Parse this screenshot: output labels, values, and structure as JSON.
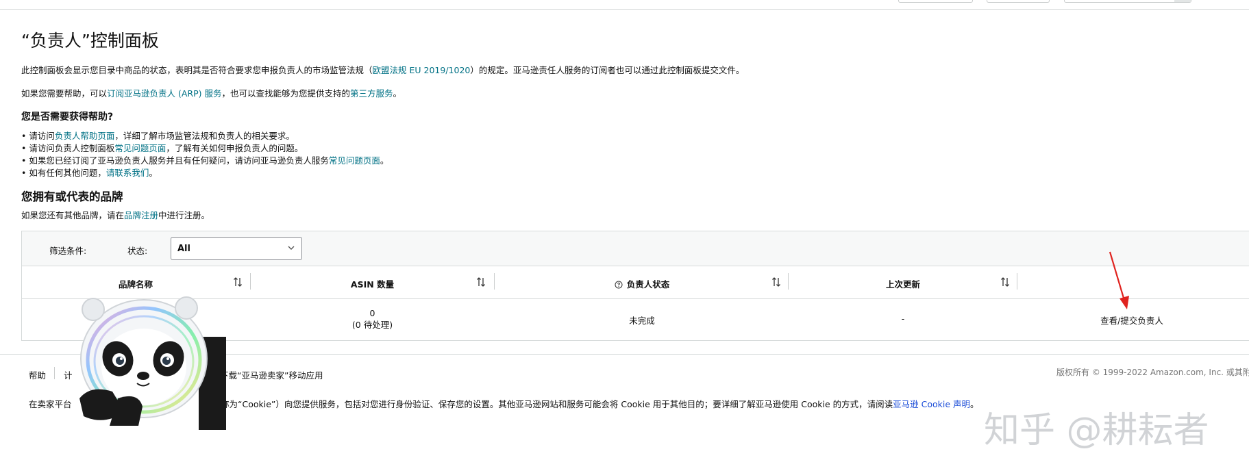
{
  "page": {
    "title": "“负责人”控制面板",
    "intro": {
      "text1": "此控制面板会显示您目录中商品的状态，表明其是否符合要求您申报负责人的市场监管法规（",
      "link": "欧盟法规 EU 2019/1020",
      "text2": "）的规定。亚马逊责任人服务的订阅者也可以通过此控制面板提交文件。"
    },
    "help_line": {
      "text1": "如果您需要帮助，可以",
      "link1": "订阅亚马逊负责人 (ARP) 服务",
      "text2": "，也可以查找能够为您提供支持的",
      "link2": "第三方服务",
      "text3": "。"
    },
    "help_heading": "您是否需要获得帮助?",
    "bullets": [
      {
        "pre": "• 请访问",
        "link": "负责人帮助页面",
        "post": "，详细了解市场监管法规和负责人的相关要求。"
      },
      {
        "pre": "• 请访问负责人控制面板",
        "link": "常见问题页面",
        "post": "，了解有关如何申报负责人的问题。"
      },
      {
        "pre": "• 如果您已经订阅了亚马逊负责人服务并且有任何疑问，请访问亚马逊负责人服务",
        "link": "常见问题页面",
        "post": "。"
      },
      {
        "pre": "• 如有任何其他问题，",
        "link": "请联系我们",
        "post": "。"
      }
    ],
    "brands_heading": "您拥有或代表的品牌",
    "brands_note": {
      "pre": "如果您还有其他品牌，请在",
      "link": "品牌注册",
      "post": "中进行注册。"
    }
  },
  "filter": {
    "label": "筛选条件:",
    "status_label": "状态:",
    "status_value": "All"
  },
  "table": {
    "columns": [
      "品牌名称",
      "ASIN 数量",
      "负责人状态",
      "上次更新"
    ],
    "row": {
      "asin_count": "0",
      "asin_pending": "(0 待处理)",
      "status": "未完成",
      "last_update": "-",
      "action": "查看/提交负责人"
    }
  },
  "footer": {
    "help": "帮助",
    "program_partial": "计",
    "download_app": "下载“亚马逊卖家”移动应用",
    "copyright": "版权所有 © 1999-2022 Amazon.com, Inc. 或其附",
    "cookie_pre": "在卖家平台",
    "cookie_mid": "称为“Cookie”）向您提供服务，包括对您进行身份验证、保存您的设置。其他亚马逊网站和服务可能会将 Cookie 用于其他目的；要详细了解亚马逊使用 Cookie 的方式，请阅读",
    "cookie_link": "亚马逊 Cookie 声明",
    "cookie_post": "。"
  },
  "watermark": "知乎 @耕耘者",
  "colors": {
    "link": "#007185",
    "annotation_arrow": "#e0231f",
    "border": "#d5d9d9"
  }
}
